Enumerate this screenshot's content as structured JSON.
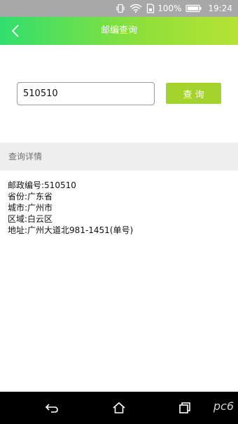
{
  "status_bar": {
    "battery_percent": "100%",
    "time": "19:24",
    "icons": [
      "vibrate-icon",
      "wifi-icon",
      "sim-icon",
      "battery-icon"
    ]
  },
  "app_bar": {
    "title": "邮编查询",
    "back_icon": "chevron-left-icon"
  },
  "search": {
    "value": "510510",
    "button_label": "查询"
  },
  "details": {
    "header": "查询详情",
    "rows": [
      "邮政编号:510510",
      "省份:广东省",
      "城市:广州市",
      "区域:白云区",
      "地址:广州大道北981-1451(单号)"
    ]
  },
  "nav_bar": {
    "icons": [
      "back-icon",
      "home-icon",
      "recents-icon"
    ],
    "watermark": "pc6"
  },
  "colors": {
    "accent": "#a5d32e",
    "gradient_start": "#30df6e",
    "gradient_end": "#b6e235",
    "status_bar": "#a8a8a8"
  }
}
